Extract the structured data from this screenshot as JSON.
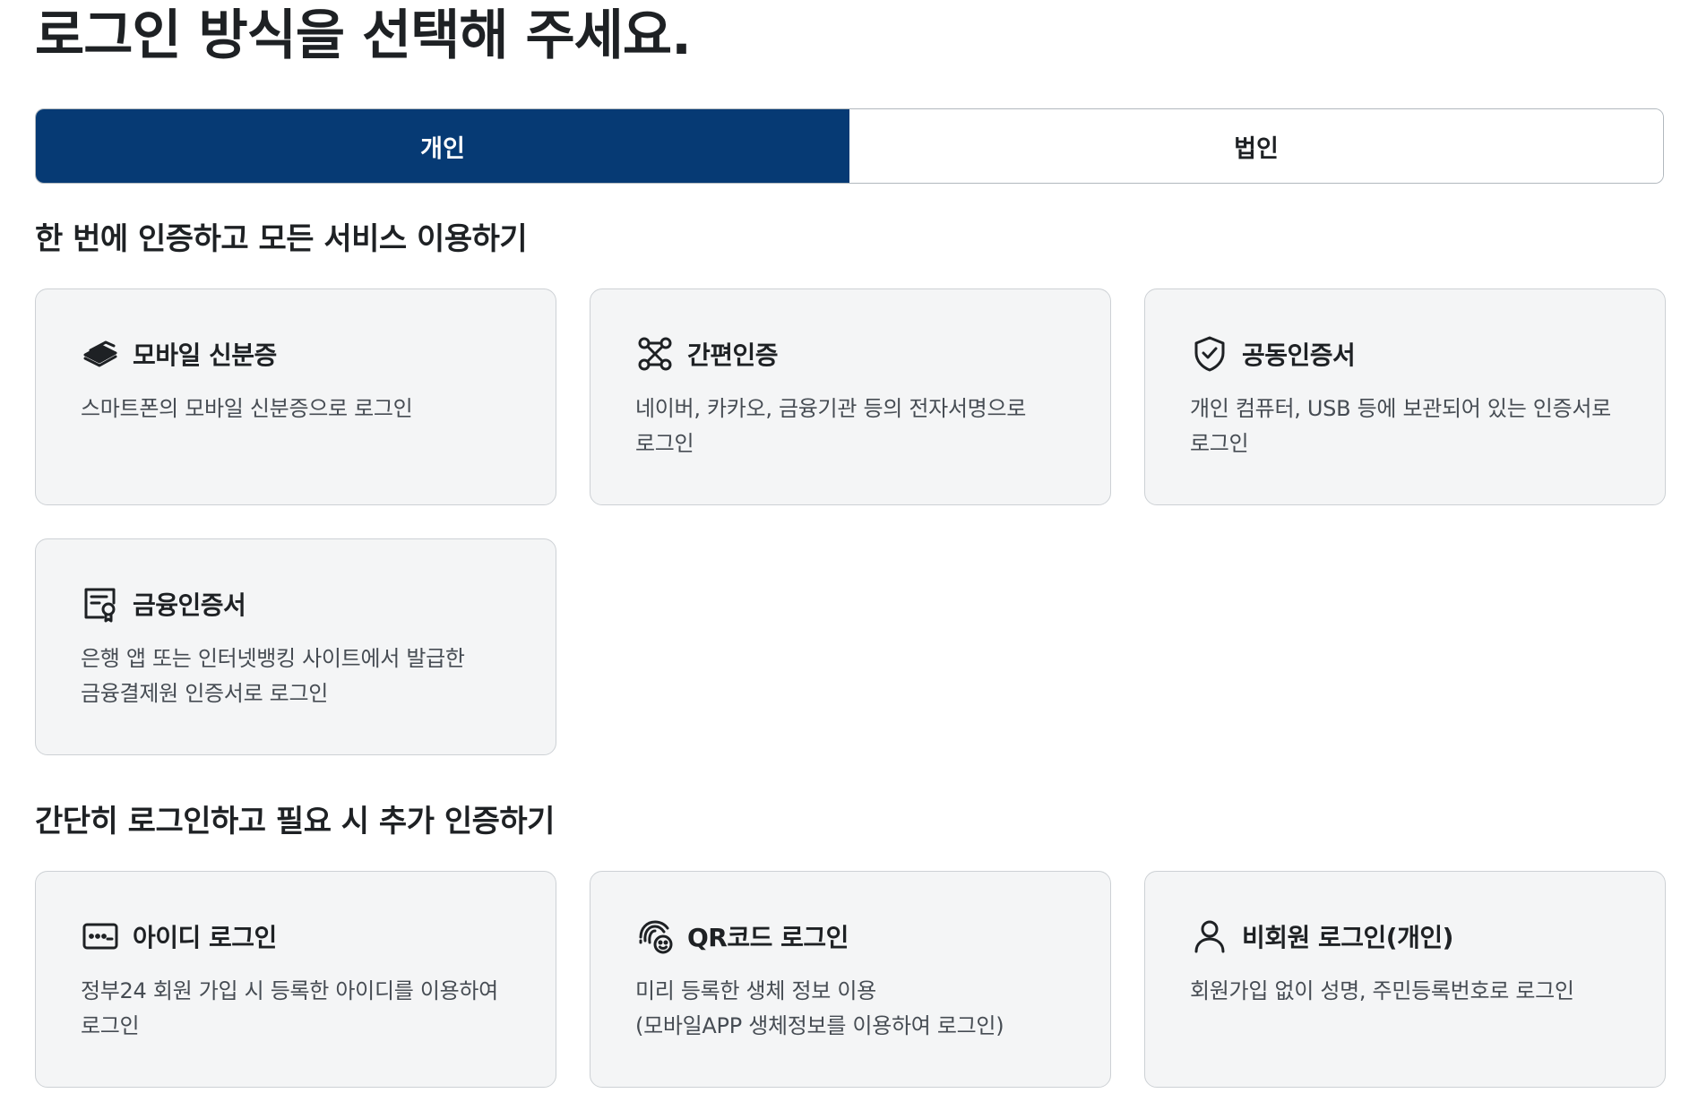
{
  "page_title": "로그인 방식을 선택해 주세요.",
  "tabs": [
    {
      "label": "개인",
      "active": true
    },
    {
      "label": "법인",
      "active": false
    }
  ],
  "colors": {
    "accent": "#063a74",
    "card_bg": "#f4f5f6",
    "card_border": "#cdd1d5",
    "text": "#1e2124",
    "subtext": "#464c53"
  },
  "section1": {
    "title": "한 번에 인증하고 모든 서비스 이용하기",
    "cards": [
      {
        "icon": "mobile-id-icon",
        "title": "모바일 신분증",
        "desc": "스마트폰의 모바일 신분증으로 로그인"
      },
      {
        "icon": "simple-auth-icon",
        "title": "간편인증",
        "desc": "네이버, 카카오, 금융기관 등의 전자서명으로\n로그인"
      },
      {
        "icon": "shield-check-icon",
        "title": "공동인증서",
        "desc": "개인 컴퓨터, USB 등에 보관되어 있는 인증서로\n로그인"
      },
      {
        "icon": "certificate-icon",
        "title": "금융인증서",
        "desc": "은행 앱 또는 인터넷뱅킹 사이트에서 발급한\n금융결제원 인증서로 로그인"
      }
    ]
  },
  "section2": {
    "title": "간단히 로그인하고 필요 시 추가 인증하기",
    "cards": [
      {
        "icon": "id-card-icon",
        "title": "아이디 로그인",
        "desc": "정부24 회원 가입 시 등록한 아이디를 이용하여\n로그인"
      },
      {
        "icon": "biometric-icon",
        "title": "QR코드 로그인",
        "desc": "미리 등록한 생체 정보 이용\n(모바일APP 생체정보를 이용하여 로그인)"
      },
      {
        "icon": "person-icon",
        "title": "비회원 로그인(개인)",
        "desc": "회원가입 없이 성명, 주민등록번호로 로그인"
      }
    ]
  }
}
